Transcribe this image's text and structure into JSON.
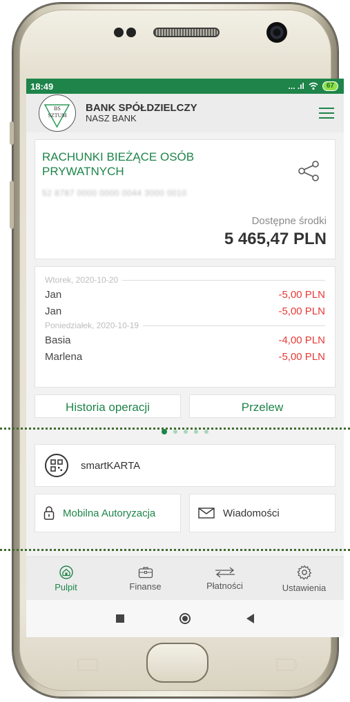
{
  "status_bar": {
    "time": "18:49",
    "signal": "... .ıl",
    "wifi_icon": "wifi-icon",
    "battery": "67"
  },
  "app_bar": {
    "logo_text_top": "BS",
    "logo_text_bottom": "SZTUM",
    "bank_name": "BANK SPÓŁDZIELCZY",
    "bank_sub": "NASZ BANK"
  },
  "account": {
    "title": "RACHUNKI BIEŻĄCE OSÓB PRYWATNYCH",
    "number": "52 8787 0000 0000 0044 3000 0010",
    "available_label": "Dostępne środki",
    "available_value": "5 465,47 PLN"
  },
  "operations": {
    "days": [
      {
        "date": "Wtorek, 2020-10-20",
        "items": [
          {
            "name": "Jan",
            "amount": "-5,00 PLN"
          },
          {
            "name": "Jan",
            "amount": "-5,00 PLN"
          }
        ]
      },
      {
        "date": "Poniedziałek, 2020-10-19",
        "items": [
          {
            "name": "Basia",
            "amount": "-4,00 PLN"
          },
          {
            "name": "Marlena",
            "amount": "-5,00 PLN"
          }
        ]
      }
    ],
    "history_button": "Historia operacji",
    "transfer_button": "Przelew"
  },
  "pager": {
    "count": 5,
    "active_index": 0
  },
  "smartkarta": {
    "label": "smartKARTA"
  },
  "tiles": {
    "mobile_auth": "Mobilna Autoryzacja",
    "messages": "Wiadomości"
  },
  "tabs": [
    {
      "label": "Pulpit",
      "icon": "home-icon",
      "active": true
    },
    {
      "label": "Finanse",
      "icon": "briefcase-icon",
      "active": false
    },
    {
      "label": "Płatności",
      "icon": "transfer-arrows-icon",
      "active": false
    },
    {
      "label": "Ustawienia",
      "icon": "gear-icon",
      "active": false
    }
  ],
  "colors": {
    "brand_green": "#1e8449",
    "negative_red": "#e53935"
  }
}
